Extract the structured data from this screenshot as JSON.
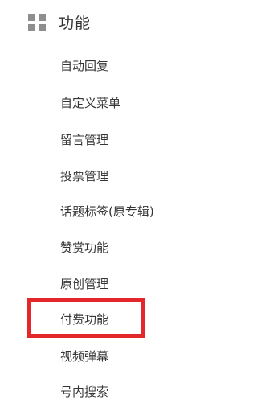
{
  "section": {
    "icon": "grid-icon",
    "title": "功能"
  },
  "menu": {
    "items": [
      {
        "label": "自动回复"
      },
      {
        "label": "自定义菜单"
      },
      {
        "label": "留言管理"
      },
      {
        "label": "投票管理"
      },
      {
        "label": "话题标签(原专辑)"
      },
      {
        "label": "赞赏功能"
      },
      {
        "label": "原创管理"
      },
      {
        "label": "付费功能"
      },
      {
        "label": "视频弹幕"
      },
      {
        "label": "号内搜索"
      }
    ],
    "highlighted_item": "付费功能"
  },
  "colors": {
    "text": "#353535",
    "icon": "#8e8e8e",
    "highlight_border": "#e3272b"
  }
}
